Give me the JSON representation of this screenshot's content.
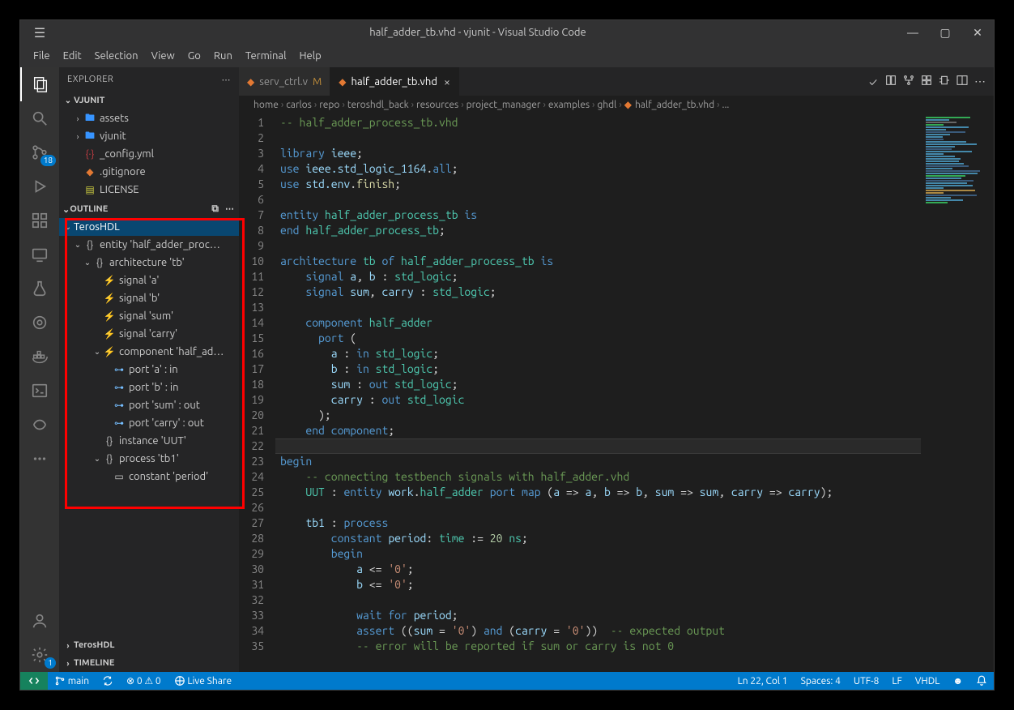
{
  "window": {
    "title": "half_adder_tb.vhd - vjunit - Visual Studio Code"
  },
  "menubar": [
    "File",
    "Edit",
    "Selection",
    "View",
    "Go",
    "Run",
    "Terminal",
    "Help"
  ],
  "activitybar": {
    "scm_badge": "18",
    "settings_badge": "1"
  },
  "explorer": {
    "header": "EXPLORER",
    "root": "VJUNIT",
    "items": [
      {
        "label": "assets",
        "type": "folder",
        "indent": 1,
        "expanded": false
      },
      {
        "label": "vjunit",
        "type": "folder",
        "indent": 1,
        "expanded": false
      },
      {
        "label": "_config.yml",
        "type": "file",
        "indent": 1,
        "icon": "brace",
        "color": "red"
      },
      {
        "label": ".gitignore",
        "type": "file",
        "indent": 1,
        "icon": "diamond",
        "color": "orange"
      },
      {
        "label": "LICENSE",
        "type": "file",
        "indent": 1,
        "icon": "cert",
        "color": "yellow"
      }
    ]
  },
  "outline": {
    "header": "OUTLINE",
    "root": "TerosHDL",
    "items": [
      {
        "label": "entity 'half_adder_proc…",
        "indent": 1,
        "icon": "brace",
        "chev": "down"
      },
      {
        "label": "architecture 'tb'",
        "indent": 2,
        "icon": "brace",
        "chev": "down"
      },
      {
        "label": "signal 'a'",
        "indent": 3,
        "icon": "sig"
      },
      {
        "label": "signal 'b'",
        "indent": 3,
        "icon": "sig"
      },
      {
        "label": "signal 'sum'",
        "indent": 3,
        "icon": "sig"
      },
      {
        "label": "signal 'carry'",
        "indent": 3,
        "icon": "sig"
      },
      {
        "label": "component 'half_ad…",
        "indent": 3,
        "icon": "sig",
        "chev": "down",
        "orange": true
      },
      {
        "label": "port 'a' : in",
        "indent": 4,
        "icon": "port"
      },
      {
        "label": "port 'b' : in",
        "indent": 4,
        "icon": "port"
      },
      {
        "label": "port 'sum' : out",
        "indent": 4,
        "icon": "port"
      },
      {
        "label": "port 'carry' : out",
        "indent": 4,
        "icon": "port"
      },
      {
        "label": "instance 'UUT'",
        "indent": 3,
        "icon": "brace"
      },
      {
        "label": "process 'tb1'",
        "indent": 3,
        "icon": "brace",
        "chev": "down"
      },
      {
        "label": "constant 'period'",
        "indent": 4,
        "icon": "const"
      }
    ],
    "timeline": "TIMELINE",
    "teroshdl": "TerosHDL"
  },
  "tabs": [
    {
      "label": "serv_ctrl.v",
      "modified": "M"
    },
    {
      "label": "half_adder_tb.vhd",
      "active": true
    }
  ],
  "breadcrumbs": [
    "home",
    "carlos",
    "repo",
    "teroshdl_back",
    "resources",
    "project_manager",
    "examples",
    "ghdl",
    "half_adder_tb.vhd",
    "..."
  ],
  "statusbar": {
    "branch": "main",
    "problems": "⊗ 0 ⚠ 0",
    "liveshare": "Live Share",
    "position": "Ln 22, Col 1",
    "spaces": "Spaces: 4",
    "encoding": "UTF-8",
    "eol": "LF",
    "lang": "VHDL"
  },
  "code_lines": [
    {
      "n": 1,
      "html": "<span class='tok-comment'>-- half_adder_process_tb.vhd</span>"
    },
    {
      "n": 2,
      "html": ""
    },
    {
      "n": 3,
      "html": "<span class='tok-kw'>library</span> <span class='tok-ident'>ieee</span>;"
    },
    {
      "n": 4,
      "html": "<span class='tok-kw'>use</span> <span class='tok-ident'>ieee.std_logic_1164</span>.<span class='tok-kw'>all</span>;"
    },
    {
      "n": 5,
      "html": "<span class='tok-kw'>use</span> <span class='tok-ident'>std.env</span>.<span class='tok-func'>finish</span>;"
    },
    {
      "n": 6,
      "html": ""
    },
    {
      "n": 7,
      "html": "<span class='tok-kw'>entity</span> <span class='tok-type'>half_adder_process_tb</span> <span class='tok-kw'>is</span>"
    },
    {
      "n": 8,
      "html": "<span class='tok-kw'>end</span> <span class='tok-type'>half_adder_process_tb</span>;"
    },
    {
      "n": 9,
      "html": ""
    },
    {
      "n": 10,
      "html": "<span class='tok-kw'>architecture</span> <span class='tok-type'>tb</span> <span class='tok-kw'>of</span> <span class='tok-type'>half_adder_process_tb</span> <span class='tok-kw'>is</span>"
    },
    {
      "n": 11,
      "html": "    <span class='tok-kw'>signal</span> <span class='tok-ident'>a</span>, <span class='tok-ident'>b</span> : <span class='tok-type'>std_logic</span>;"
    },
    {
      "n": 12,
      "html": "    <span class='tok-kw'>signal</span> <span class='tok-ident'>sum</span>, <span class='tok-ident'>carry</span> : <span class='tok-type'>std_logic</span>;"
    },
    {
      "n": 13,
      "html": ""
    },
    {
      "n": 14,
      "html": "    <span class='tok-kw'>component</span> <span class='tok-type'>half_adder</span>"
    },
    {
      "n": 15,
      "html": "      <span class='tok-kw'>port</span> ("
    },
    {
      "n": 16,
      "html": "        <span class='tok-ident'>a</span> : <span class='tok-kw'>in</span> <span class='tok-type'>std_logic</span>;"
    },
    {
      "n": 17,
      "html": "        <span class='tok-ident'>b</span> : <span class='tok-kw'>in</span> <span class='tok-type'>std_logic</span>;"
    },
    {
      "n": 18,
      "html": "        <span class='tok-ident'>sum</span> : <span class='tok-kw'>out</span> <span class='tok-type'>std_logic</span>;"
    },
    {
      "n": 19,
      "html": "        <span class='tok-ident'>carry</span> : <span class='tok-kw'>out</span> <span class='tok-type'>std_logic</span>"
    },
    {
      "n": 20,
      "html": "      );"
    },
    {
      "n": 21,
      "html": "    <span class='tok-kw'>end</span> <span class='tok-kw'>component</span>;"
    },
    {
      "n": 22,
      "html": "",
      "hl": true
    },
    {
      "n": 23,
      "html": "<span class='tok-kw'>begin</span>"
    },
    {
      "n": 24,
      "html": "    <span class='tok-comment'>-- connecting testbench signals with half_adder.vhd</span>"
    },
    {
      "n": 25,
      "html": "    <span class='tok-type'>UUT</span> : <span class='tok-kw'>entity</span> <span class='tok-ident'>work</span>.<span class='tok-type'>half_adder</span> <span class='tok-kw'>port</span> <span class='tok-kw'>map</span> (<span class='tok-ident'>a</span> =&gt; <span class='tok-ident'>a</span>, <span class='tok-ident'>b</span> =&gt; <span class='tok-ident'>b</span>, <span class='tok-ident'>sum</span> =&gt; <span class='tok-ident'>sum</span>, <span class='tok-ident'>carry</span> =&gt; <span class='tok-ident'>carry</span>);"
    },
    {
      "n": 26,
      "html": ""
    },
    {
      "n": 27,
      "html": "    <span class='tok-ident'>tb1</span> : <span class='tok-kw'>process</span>"
    },
    {
      "n": 28,
      "html": "        <span class='tok-kw'>constant</span> <span class='tok-ident'>period</span>: <span class='tok-type'>time</span> := <span class='tok-num'>20</span> <span class='tok-type'>ns</span>;"
    },
    {
      "n": 29,
      "html": "        <span class='tok-kw'>begin</span>"
    },
    {
      "n": 30,
      "html": "            <span class='tok-ident'>a</span> &lt;= <span class='tok-str'>'0'</span>;"
    },
    {
      "n": 31,
      "html": "            <span class='tok-ident'>b</span> &lt;= <span class='tok-str'>'0'</span>;"
    },
    {
      "n": 32,
      "html": ""
    },
    {
      "n": 33,
      "html": "            <span class='tok-kw'>wait</span> <span class='tok-kw'>for</span> <span class='tok-ident'>period</span>;"
    },
    {
      "n": 34,
      "html": "            <span class='tok-kw'>assert</span> ((<span class='tok-ident'>sum</span> = <span class='tok-str'>'0'</span>) <span class='tok-kw'>and</span> (<span class='tok-ident'>carry</span> = <span class='tok-str'>'0'</span>))  <span class='tok-comment'>-- expected output</span>"
    },
    {
      "n": 35,
      "html": "            <span class='tok-comment'>-- error will be reported if sum or carry is not 0</span>"
    }
  ]
}
